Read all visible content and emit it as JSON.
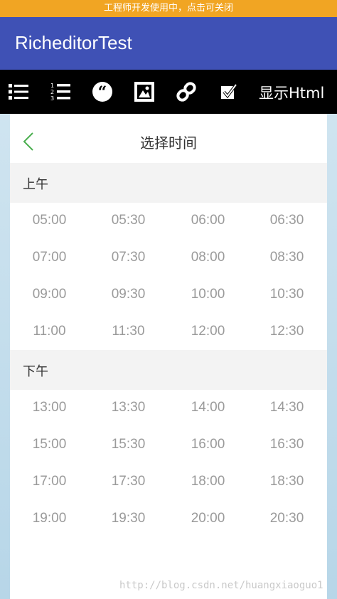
{
  "banner": "工程师开发使用中，点击可关闭",
  "app": {
    "title": "RicheditorTest"
  },
  "toolbar": {
    "items": [
      {
        "icon": "bullet-list-icon"
      },
      {
        "icon": "numbered-list-icon"
      },
      {
        "icon": "blockquote-icon"
      },
      {
        "icon": "insert-image-icon"
      },
      {
        "icon": "insert-link-icon"
      },
      {
        "icon": "checkbox-icon"
      }
    ],
    "html_label": "显示Html"
  },
  "picker": {
    "title": "选择时间",
    "morning_label": "上午",
    "afternoon_label": "下午",
    "morning_slots": [
      "05:00",
      "05:30",
      "06:00",
      "06:30",
      "07:00",
      "07:30",
      "08:00",
      "08:30",
      "09:00",
      "09:30",
      "10:00",
      "10:30",
      "11:00",
      "11:30",
      "12:00",
      "12:30"
    ],
    "afternoon_slots": [
      "13:00",
      "13:30",
      "14:00",
      "14:30",
      "15:00",
      "15:30",
      "16:00",
      "16:30",
      "17:00",
      "17:30",
      "18:00",
      "18:30",
      "19:00",
      "19:30",
      "20:00",
      "20:30"
    ]
  },
  "colors": {
    "banner": "#f1a523",
    "appbar": "#3f51b5",
    "toolbar": "#000000",
    "back_arrow": "#4caf50",
    "slot_text": "#9a9a9a"
  },
  "watermark": "http://blog.csdn.net/huangxiaoguo1"
}
